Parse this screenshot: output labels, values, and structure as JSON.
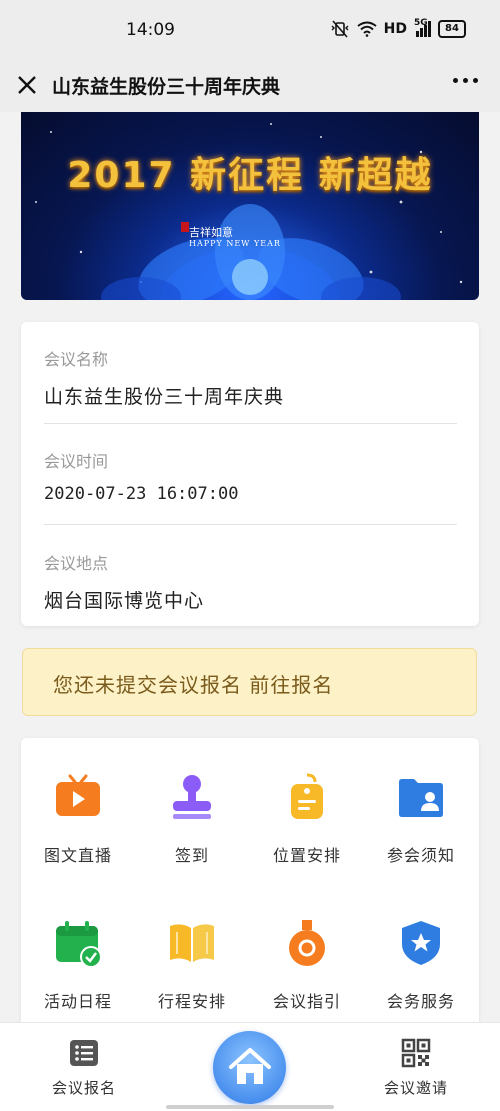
{
  "status_bar": {
    "time": "14:09",
    "network": "HD",
    "network_small": "5G",
    "battery": "84"
  },
  "nav": {
    "title": "山东益生股份三十周年庆典",
    "close_icon": "close-icon",
    "more_icon": "more-dots-icon"
  },
  "banner": {
    "headline": "2017 新征程 新超越",
    "caption": "吉祥如意",
    "caption_sub": "HAPPY NEW YEAR"
  },
  "meeting": {
    "name_label": "会议名称",
    "name_value": "山东益生股份三十周年庆典",
    "time_label": "会议时间",
    "time_value": "2020-07-23 16:07:00",
    "place_label": "会议地点",
    "place_value": "烟台国际博览中心"
  },
  "notice": {
    "text": "您还未提交会议报名 前往报名"
  },
  "features": [
    {
      "label": "图文直播",
      "icon": "tv-live-icon",
      "color": "#f57c1f"
    },
    {
      "label": "签到",
      "icon": "stamp-icon",
      "color": "#8b5cf6"
    },
    {
      "label": "位置安排",
      "icon": "seat-tag-icon",
      "color": "#f7b928"
    },
    {
      "label": "参会须知",
      "icon": "folder-user-icon",
      "color": "#2f7de1"
    },
    {
      "label": "活动日程",
      "icon": "calendar-check-icon",
      "color": "#22b14c"
    },
    {
      "label": "行程安排",
      "icon": "open-book-icon",
      "color": "#f7b928"
    },
    {
      "label": "会议指引",
      "icon": "medal-icon",
      "color": "#f57c1f"
    },
    {
      "label": "会务服务",
      "icon": "shield-star-icon",
      "color": "#2f7de1"
    }
  ],
  "tabs": {
    "left_label": "会议报名",
    "left_icon": "list-icon",
    "center_icon": "home-icon",
    "right_label": "会议邀请",
    "right_icon": "qr-code-icon"
  },
  "colors": {
    "notice_bg": "#fdf1c7",
    "notice_text": "#7a5b1c",
    "home_button": "#4a90ee",
    "banner_gold": "#f4c13c"
  }
}
